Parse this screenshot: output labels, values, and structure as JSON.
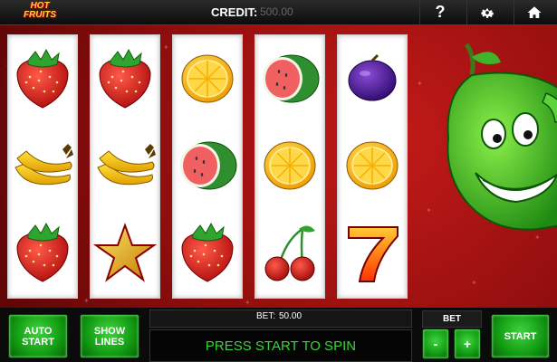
{
  "logo": {
    "line1": "HOT",
    "line2": "FRUITS"
  },
  "credit": {
    "label": "CREDIT:",
    "value": "500.00"
  },
  "top_icons": [
    "help-icon",
    "gear-icon",
    "home-icon"
  ],
  "help_label": "?",
  "reels": [
    [
      "strawberry",
      "banana",
      "strawberry"
    ],
    [
      "strawberry",
      "banana",
      "star"
    ],
    [
      "lemon",
      "watermelon",
      "strawberry"
    ],
    [
      "watermelon",
      "lemon",
      "cherries"
    ],
    [
      "plum",
      "lemon",
      "seven"
    ]
  ],
  "buttons": {
    "auto_start": "AUTO\nSTART",
    "show_lines": "SHOW\nLINES",
    "bet_minus": "-",
    "bet_plus": "+",
    "start": "START"
  },
  "bet": {
    "label": "BET:",
    "value": "50.00",
    "header": "BET"
  },
  "message": "PRESS START TO SPIN",
  "colors": {
    "accent_green": "#129a12",
    "message_green": "#37d637",
    "field_red": "#8c0d0d"
  }
}
